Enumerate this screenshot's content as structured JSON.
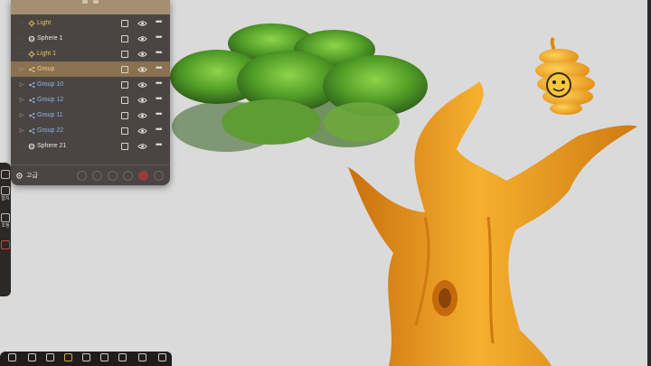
{
  "scene_panel": {
    "rows": [
      {
        "label": "Light",
        "type": "light",
        "selected": false
      },
      {
        "label": "Sphere 1",
        "type": "sphere",
        "selected": false
      },
      {
        "label": "Light 1",
        "type": "light",
        "selected": false
      },
      {
        "label": "Group",
        "type": "group",
        "selected": true
      },
      {
        "label": "Group 10",
        "type": "group",
        "selected": false
      },
      {
        "label": "Group 12",
        "type": "group",
        "selected": false
      },
      {
        "label": "Group 11",
        "type": "group",
        "selected": false
      },
      {
        "label": "Group 22",
        "type": "group",
        "selected": false
      },
      {
        "label": "Sphere 21",
        "type": "sphere",
        "selected": false
      }
    ],
    "footer_label": "고급"
  },
  "tool_strip": {
    "items": [
      "합치",
      "조정"
    ]
  },
  "bottom_toolbar": {
    "items": [
      "",
      "",
      "",
      "",
      "",
      "",
      "",
      "",
      ""
    ]
  },
  "colors": {
    "panel_bg": "#4a4542",
    "selected_row": "#8a7150",
    "light_label": "#e9c460",
    "group_label": "#8fb2ee",
    "accent": "#e0a23a"
  }
}
